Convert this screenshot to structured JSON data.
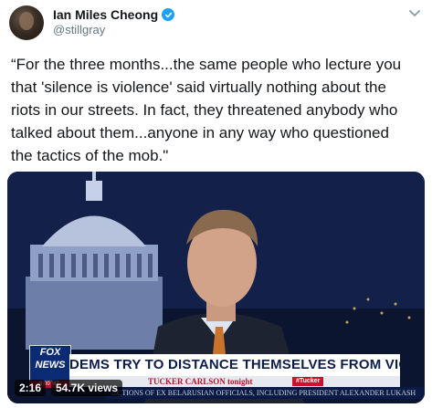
{
  "author": {
    "display_name": "Ian Miles Cheong",
    "handle": "@stillgray",
    "verified": true
  },
  "icons": {
    "verified": "verified-badge-icon",
    "menu": "chevron-down-icon"
  },
  "tweet": {
    "text_lines": [
      "“For the three months...the same people who lecture you",
      "that 'silence is violence' said virtually nothing about the",
      "riots in our streets. In fact, they threatened anybody who",
      "talked about them...anyone in any way who questioned",
      "the tactics of the mob.\""
    ]
  },
  "video": {
    "duration": "2:16",
    "views": "54.7K views",
    "lower_third": {
      "network_line1": "FOX",
      "network_line2": "NEWS",
      "time": "8:00 MT",
      "headline": "DEMS TRY TO DISTANCE THEMSELVES FROM VIOLENCE",
      "show": "TUCKER CARLSON tonight",
      "tag": "#Tucker",
      "ticker": "...CTIONS OF EX BELARUSIAN OFFICIALS, INCLUDING PRESIDENT ALEXANDER LUKASH"
    }
  },
  "colors": {
    "verified_blue": "#1da1f2",
    "text": "#14171a",
    "secondary_text": "#657786",
    "fox_blue": "#0c2b75",
    "fox_red": "#b3122a"
  }
}
